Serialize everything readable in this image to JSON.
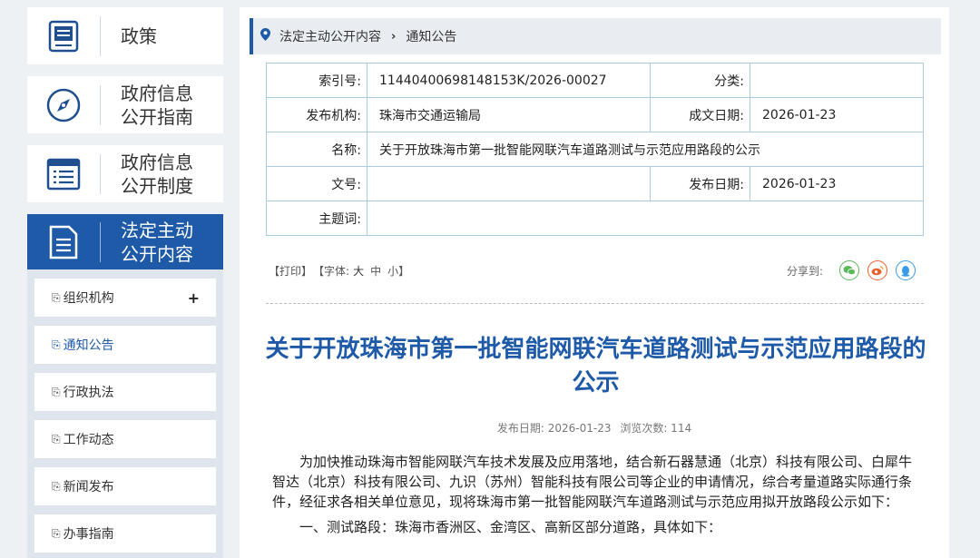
{
  "sidebar": {
    "categories": [
      {
        "label": "政策",
        "icon": "book-icon"
      },
      {
        "label": "政府信息\n公开指南",
        "icon": "compass-icon"
      },
      {
        "label": "政府信息\n公开制度",
        "icon": "list-icon"
      },
      {
        "label": "法定主动\n公开内容",
        "icon": "document-icon"
      }
    ],
    "subitems": [
      {
        "label": "组织机构",
        "expand": "+"
      },
      {
        "label": "通知公告"
      },
      {
        "label": "行政执法"
      },
      {
        "label": "工作动态"
      },
      {
        "label": "新闻发布"
      },
      {
        "label": "办事指南"
      }
    ]
  },
  "breadcrumb": {
    "first": "法定主动公开内容",
    "second": "通知公告"
  },
  "meta": {
    "index_label": "索引号:",
    "index_value": "11440400698148153K/2026-00027",
    "category_label": "分类:",
    "category_value": "",
    "publisher_label": "发布机构:",
    "publisher_value": "珠海市交通运输局",
    "created_label": "成文日期:",
    "created_value": "2026-01-23",
    "name_label": "名称:",
    "name_value": "关于开放珠海市第一批智能网联汽车道路测试与示范应用路段的公示",
    "docno_label": "文号:",
    "docno_value": "",
    "pubdate_label": "发布日期:",
    "pubdate_value": "2026-01-23",
    "subject_label": "主题词:",
    "subject_value": ""
  },
  "tools": {
    "print": "【打印】",
    "font": "【字体:",
    "big": "大",
    "mid": "中",
    "small": "小】"
  },
  "share": {
    "label": "分享到:",
    "icons": [
      "wechat-icon",
      "weibo-icon",
      "qq-icon"
    ]
  },
  "article": {
    "title": "关于开放珠海市第一批智能网联汽车道路测试与示范应用路段的公示",
    "date": "发布日期: 2026-01-23",
    "views": "浏览次数: 114",
    "paragraphs": [
      "为加快推动珠海市智能网联汽车技术发展及应用落地，结合新石器慧通（北京）科技有限公司、白犀牛智达（北京）科技有限公司、九识（苏州）智能科技有限公司等企业的申请情况，综合考量道路实际通行条件，经征求各相关单位意见，现将珠海市第一批智能网联汽车道路测试与示范应用拟开放路段公示如下：",
      "一、测试路段：珠海市香洲区、金湾区、高新区部分道路，具体如下："
    ]
  },
  "colors": {
    "accent": "#1e5aa8",
    "table_border": "#a9cbe4"
  }
}
